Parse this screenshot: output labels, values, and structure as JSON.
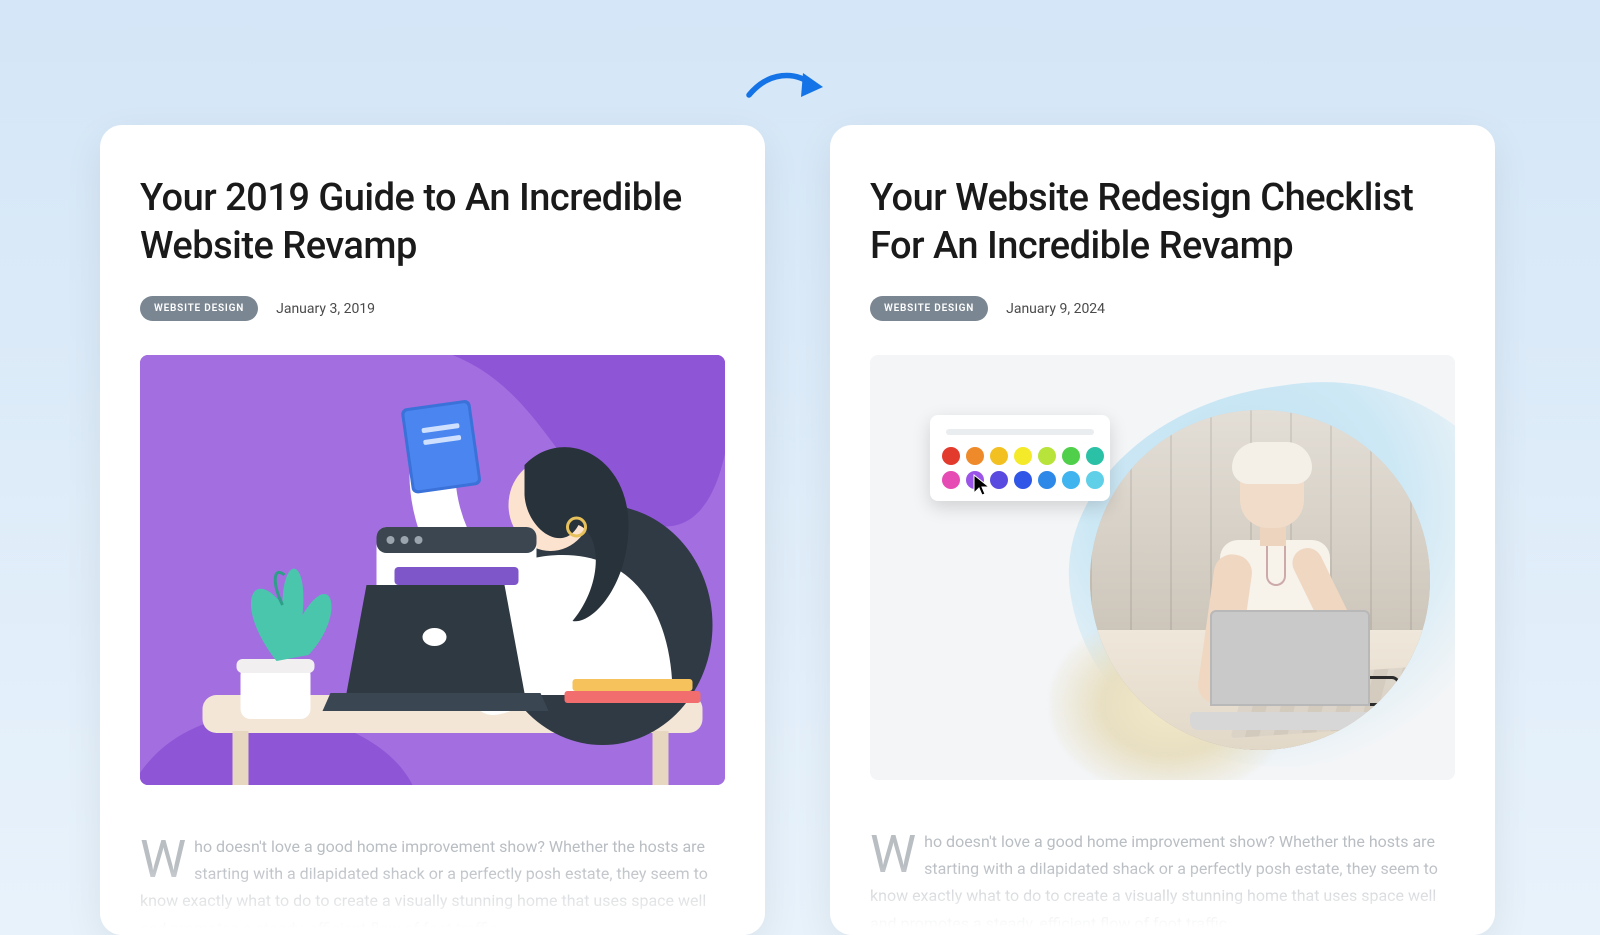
{
  "left": {
    "title": "Your 2019 Guide to An Incredible Website Revamp",
    "badge": "WEBSITE DESIGN",
    "date": "January 3, 2019",
    "body_dropcap": "W",
    "body_text": "ho doesn't love a good home improvement show? Whether the hosts are starting with a dilapidated shack or a perfectly posh estate, they seem to know exactly what to do to create a visually stunning home that uses space well and promotes a steady, efficient flow of foot traffic."
  },
  "right": {
    "title": "Your Website Redesign Checklist For An Incredible Revamp",
    "badge": "WEBSITE DESIGN",
    "date": "January 9, 2024",
    "body_dropcap": "W",
    "body_text": "ho doesn't love a good home improvement show? Whether the hosts are starting with a dilapidated shack or a perfectly posh estate, they seem to know exactly what to do to create a visually stunning home that uses space well and promotes a steady, efficient flow of foot traffic."
  },
  "palette_colors": [
    "#e23b2e",
    "#ef8a2b",
    "#f3c022",
    "#f4ea29",
    "#b7e33a",
    "#4fcf4a",
    "#2bc1a6",
    "#e54bb3",
    "#9a55e8",
    "#5a4be0",
    "#2f56e6",
    "#2e88e8",
    "#3fb4ef",
    "#5fd0e8"
  ]
}
